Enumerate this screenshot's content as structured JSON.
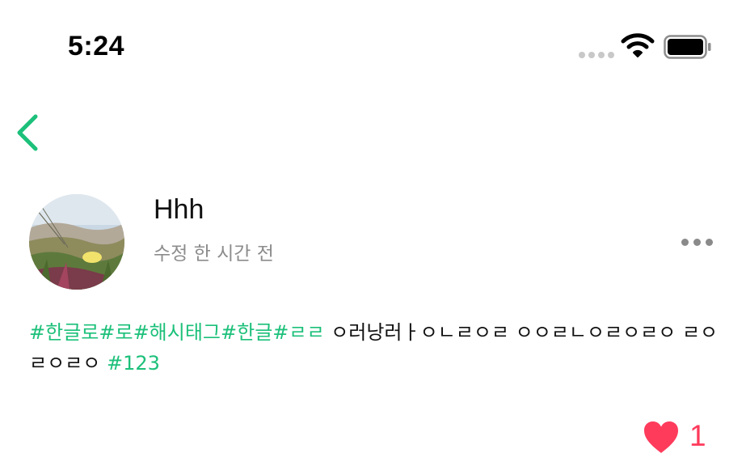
{
  "status_bar": {
    "time": "5:24"
  },
  "header": {
    "back_icon": "chevron-left-icon",
    "accent_color": "#1cc07a"
  },
  "post": {
    "author": "Hhh",
    "time_ago": "수정 한 시간 전",
    "more_icon": "more-horizontal-icon",
    "content": [
      {
        "type": "hashtag",
        "text": "#한글로"
      },
      {
        "type": "hashtag",
        "text": "#로"
      },
      {
        "type": "hashtag",
        "text": "#해시태그"
      },
      {
        "type": "hashtag",
        "text": "#한글"
      },
      {
        "type": "hashtag",
        "text": "#ㄹㄹ"
      },
      {
        "type": "text",
        "text": " ㅇ러낭러ㅏㅇㄴㄹㅇㄹ ㅇㅇㄹㄴㅇㄹㅇㄹㅇ ㄹㅇㄹㅇㄹㅇ "
      },
      {
        "type": "hashtag",
        "text": "#123"
      }
    ],
    "like_icon": "heart-icon",
    "like_color": "#ff3b5c",
    "like_count": "1"
  }
}
